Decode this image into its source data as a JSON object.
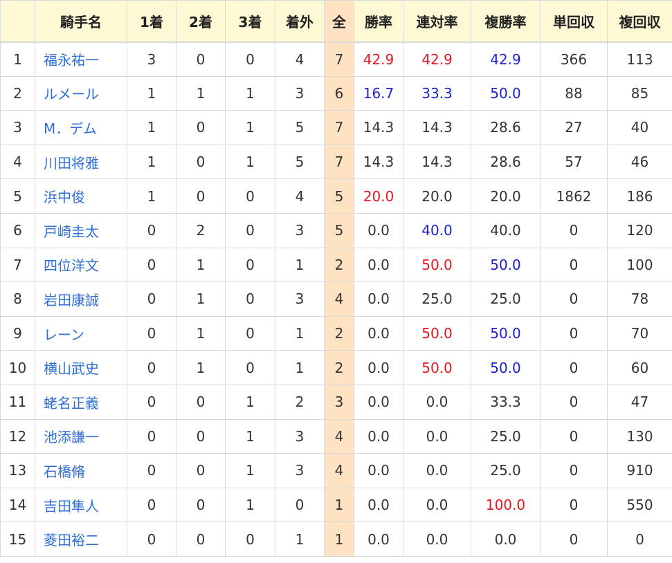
{
  "colors": {
    "header_bg": "#fdf9d4",
    "total_bg": "#fde2c4",
    "name_link": "#2f6fd8",
    "highlight_red": "#e8141f",
    "highlight_blue": "#1a1fd6"
  },
  "headers": [
    "",
    "騎手名",
    "1着",
    "2着",
    "3着",
    "着外",
    "全",
    "勝率",
    "連対率",
    "複勝率",
    "単回収",
    "複回収"
  ],
  "rows": [
    {
      "rank": "1",
      "name": "福永祐一",
      "first": "3",
      "second": "0",
      "third": "0",
      "out": "4",
      "total": "7",
      "win": "42.9",
      "win_c": "red",
      "quinella": "42.9",
      "quinella_c": "red",
      "show": "42.9",
      "show_c": "blue",
      "win_return": "366",
      "show_return": "113"
    },
    {
      "rank": "2",
      "name": "ルメール",
      "first": "1",
      "second": "1",
      "third": "1",
      "out": "3",
      "total": "6",
      "win": "16.7",
      "win_c": "blue",
      "quinella": "33.3",
      "quinella_c": "blue",
      "show": "50.0",
      "show_c": "blue",
      "win_return": "88",
      "show_return": "85"
    },
    {
      "rank": "3",
      "name": "M．デム",
      "first": "1",
      "second": "0",
      "third": "1",
      "out": "5",
      "total": "7",
      "win": "14.3",
      "win_c": "",
      "quinella": "14.3",
      "quinella_c": "",
      "show": "28.6",
      "show_c": "",
      "win_return": "27",
      "show_return": "40"
    },
    {
      "rank": "4",
      "name": "川田将雅",
      "first": "1",
      "second": "0",
      "third": "1",
      "out": "5",
      "total": "7",
      "win": "14.3",
      "win_c": "",
      "quinella": "14.3",
      "quinella_c": "",
      "show": "28.6",
      "show_c": "",
      "win_return": "57",
      "show_return": "46"
    },
    {
      "rank": "5",
      "name": "浜中俊",
      "first": "1",
      "second": "0",
      "third": "0",
      "out": "4",
      "total": "5",
      "win": "20.0",
      "win_c": "red",
      "quinella": "20.0",
      "quinella_c": "",
      "show": "20.0",
      "show_c": "",
      "win_return": "1862",
      "show_return": "186"
    },
    {
      "rank": "6",
      "name": "戸崎圭太",
      "first": "0",
      "second": "2",
      "third": "0",
      "out": "3",
      "total": "5",
      "win": "0.0",
      "win_c": "",
      "quinella": "40.0",
      "quinella_c": "blue",
      "show": "40.0",
      "show_c": "",
      "win_return": "0",
      "show_return": "120"
    },
    {
      "rank": "7",
      "name": "四位洋文",
      "first": "0",
      "second": "1",
      "third": "0",
      "out": "1",
      "total": "2",
      "win": "0.0",
      "win_c": "",
      "quinella": "50.0",
      "quinella_c": "red",
      "show": "50.0",
      "show_c": "blue",
      "win_return": "0",
      "show_return": "100"
    },
    {
      "rank": "8",
      "name": "岩田康誠",
      "first": "0",
      "second": "1",
      "third": "0",
      "out": "3",
      "total": "4",
      "win": "0.0",
      "win_c": "",
      "quinella": "25.0",
      "quinella_c": "",
      "show": "25.0",
      "show_c": "",
      "win_return": "0",
      "show_return": "78"
    },
    {
      "rank": "9",
      "name": "レーン",
      "first": "0",
      "second": "1",
      "third": "0",
      "out": "1",
      "total": "2",
      "win": "0.0",
      "win_c": "",
      "quinella": "50.0",
      "quinella_c": "red",
      "show": "50.0",
      "show_c": "blue",
      "win_return": "0",
      "show_return": "70"
    },
    {
      "rank": "10",
      "name": "横山武史",
      "first": "0",
      "second": "1",
      "third": "0",
      "out": "1",
      "total": "2",
      "win": "0.0",
      "win_c": "",
      "quinella": "50.0",
      "quinella_c": "red",
      "show": "50.0",
      "show_c": "blue",
      "win_return": "0",
      "show_return": "60"
    },
    {
      "rank": "11",
      "name": "蛯名正義",
      "first": "0",
      "second": "0",
      "third": "1",
      "out": "2",
      "total": "3",
      "win": "0.0",
      "win_c": "",
      "quinella": "0.0",
      "quinella_c": "",
      "show": "33.3",
      "show_c": "",
      "win_return": "0",
      "show_return": "47"
    },
    {
      "rank": "12",
      "name": "池添謙一",
      "first": "0",
      "second": "0",
      "third": "1",
      "out": "3",
      "total": "4",
      "win": "0.0",
      "win_c": "",
      "quinella": "0.0",
      "quinella_c": "",
      "show": "25.0",
      "show_c": "",
      "win_return": "0",
      "show_return": "130"
    },
    {
      "rank": "13",
      "name": "石橋脩",
      "first": "0",
      "second": "0",
      "third": "1",
      "out": "3",
      "total": "4",
      "win": "0.0",
      "win_c": "",
      "quinella": "0.0",
      "quinella_c": "",
      "show": "25.0",
      "show_c": "",
      "win_return": "0",
      "show_return": "910"
    },
    {
      "rank": "14",
      "name": "吉田隼人",
      "first": "0",
      "second": "0",
      "third": "1",
      "out": "0",
      "total": "1",
      "win": "0.0",
      "win_c": "",
      "quinella": "0.0",
      "quinella_c": "",
      "show": "100.0",
      "show_c": "red",
      "win_return": "0",
      "show_return": "550"
    },
    {
      "rank": "15",
      "name": "菱田裕二",
      "first": "0",
      "second": "0",
      "third": "0",
      "out": "1",
      "total": "1",
      "win": "0.0",
      "win_c": "",
      "quinella": "0.0",
      "quinella_c": "",
      "show": "0.0",
      "show_c": "",
      "win_return": "0",
      "show_return": "0"
    }
  ]
}
